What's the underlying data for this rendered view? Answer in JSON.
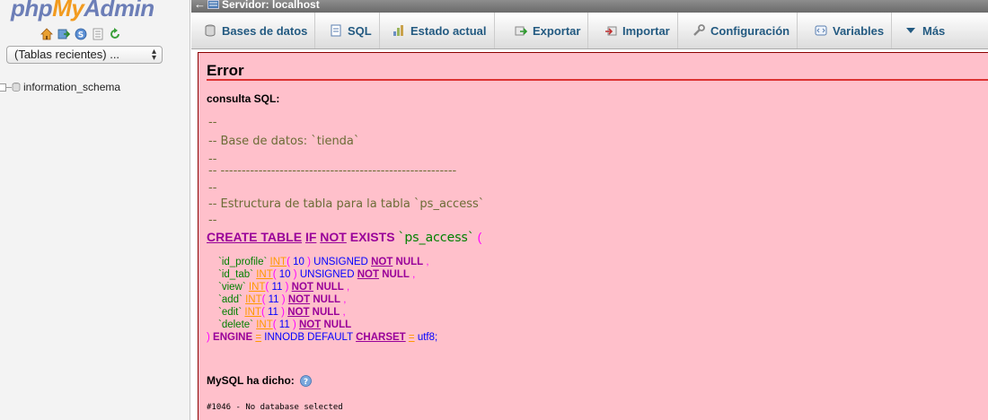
{
  "sidebar": {
    "logo_php": "php",
    "logo_my": "My",
    "logo_admin": "Admin",
    "quick_icons": [
      "home-icon",
      "exit-icon",
      "query-window-icon",
      "documentation-icon",
      "reload-icon"
    ],
    "recent_tables": "(Tablas recientes) ...",
    "databases": [
      {
        "name": "information_schema"
      }
    ]
  },
  "topbar": {
    "back": "←",
    "server": "Servidor: localhost"
  },
  "tabs": [
    {
      "label": "Bases de datos",
      "icon": "database-icon"
    },
    {
      "label": "SQL",
      "icon": "sql-icon"
    },
    {
      "label": "Estado actual",
      "icon": "status-icon"
    },
    {
      "label": "Exportar",
      "icon": "export-icon"
    },
    {
      "label": "Importar",
      "icon": "import-icon"
    },
    {
      "label": "Configuración",
      "icon": "wrench-icon"
    },
    {
      "label": "Variables",
      "icon": "variables-icon"
    },
    {
      "label": "Más",
      "icon": "triangle-down-icon"
    }
  ],
  "error": {
    "title": "Error",
    "sql_label": "consulta SQL:",
    "comments": [
      "--",
      "-- Base de datos: `tienda`",
      "--",
      "-- --------------------------------------------------------",
      "--",
      "-- Estructura de tabla para la tabla `ps_access`",
      "--"
    ],
    "create": {
      "kw1": "CREATE TABLE",
      "kw2": "IF",
      "kw3": "NOT",
      "kw4": "EXISTS",
      "table": "`ps_access`",
      "paren": "("
    },
    "columns": [
      {
        "name": "`id_profile`",
        "type": "INT",
        "size": "10",
        "extra": "UNSIGNED",
        "not": "NOT",
        "null": "NULL",
        "sep": ","
      },
      {
        "name": "`id_tab`",
        "type": "INT",
        "size": "10",
        "extra": "UNSIGNED",
        "not": "NOT",
        "null": "NULL",
        "sep": ","
      },
      {
        "name": "`view`",
        "type": "INT",
        "size": "11",
        "extra": "",
        "not": "NOT",
        "null": "NULL",
        "sep": ","
      },
      {
        "name": "`add`",
        "type": "INT",
        "size": "11",
        "extra": "",
        "not": "NOT",
        "null": "NULL",
        "sep": ","
      },
      {
        "name": "`edit`",
        "type": "INT",
        "size": "11",
        "extra": "",
        "not": "NOT",
        "null": "NULL",
        "sep": ","
      },
      {
        "name": "`delete`",
        "type": "INT",
        "size": "11",
        "extra": "",
        "not": "NOT",
        "null": "NULL",
        "sep": ""
      }
    ],
    "engine_line": {
      "close": ")",
      "engine": "ENGINE",
      "eq1": "=",
      "innodb_default": "INNODB DEFAULT",
      "charset": "CHARSET",
      "eq2": "=",
      "utf": "utf8;"
    },
    "mysql_said": "MySQL ha dicho:",
    "code": "#1046 - No database selected"
  }
}
